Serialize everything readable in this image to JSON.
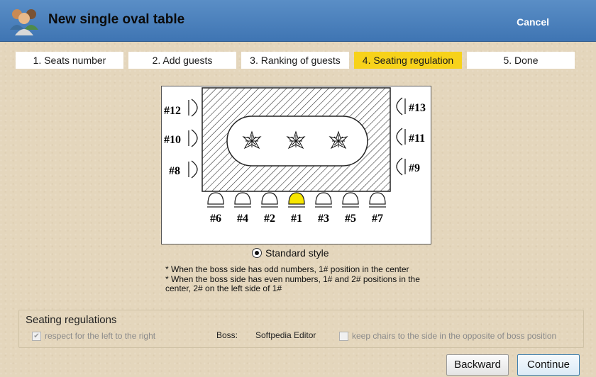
{
  "window": {
    "title": "New single oval table",
    "cancel_label": "Cancel"
  },
  "steps": [
    {
      "label": "1. Seats number"
    },
    {
      "label": "2. Add guests"
    },
    {
      "label": "3. Ranking of guests"
    },
    {
      "label": "4. Seating regulation",
      "active": true
    },
    {
      "label": "5. Done"
    }
  ],
  "diagram": {
    "left_seats": [
      "#12",
      "#10",
      "#8"
    ],
    "right_seats": [
      "#13",
      "#11",
      "#9"
    ],
    "bottom_seats": [
      "#6",
      "#4",
      "#2",
      "#1",
      "#3",
      "#5",
      "#7"
    ],
    "highlighted_seat": "#1",
    "highlight_color": "#f7e600"
  },
  "style_option": {
    "label": "Standard style",
    "selected": true
  },
  "notes": {
    "line1": "* When the boss side has odd numbers, 1# position in the center",
    "line2a": "* When the boss side has even numbers, 1# and 2# positions in the",
    "line2b": "center, 2# on the left side of 1#"
  },
  "regulations": {
    "title": "Seating regulations",
    "respect_label": "respect for the left to the right",
    "respect_checked": true,
    "boss_label": "Boss:",
    "boss_value": "Softpedia Editor",
    "opposite_label": "keep chairs to the side in the opposite of boss position",
    "opposite_checked": false
  },
  "buttons": {
    "backward": "Backward",
    "continue": "Continue"
  }
}
